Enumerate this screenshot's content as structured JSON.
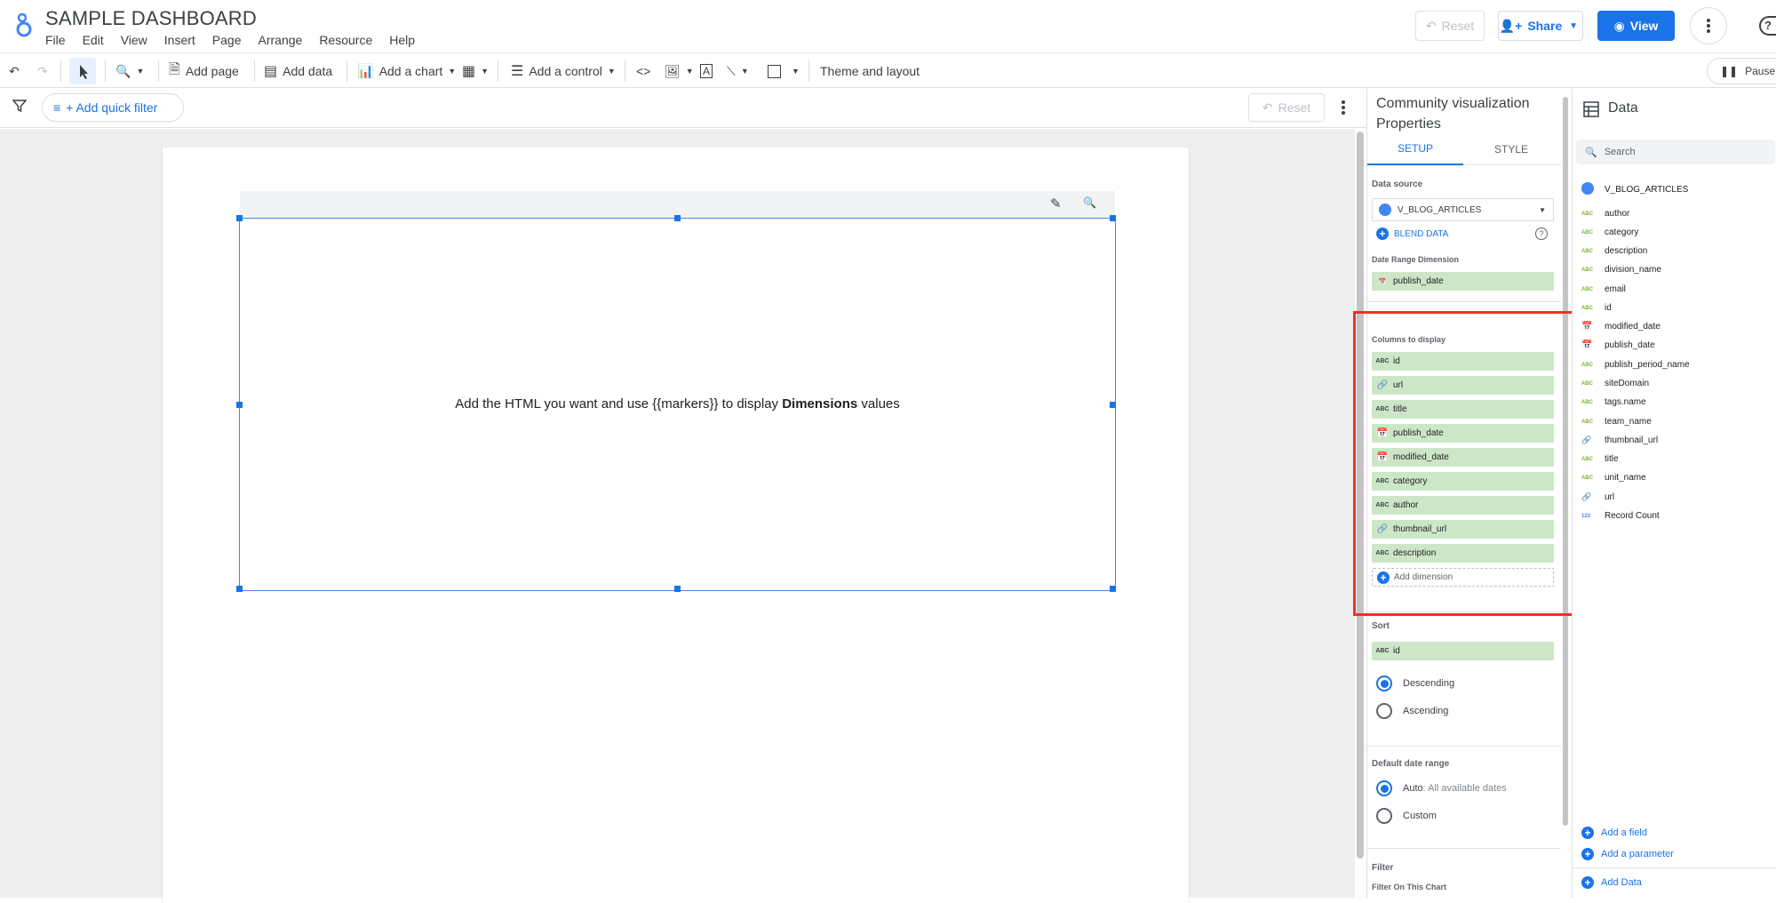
{
  "header": {
    "title": "SAMPLE DASHBOARD",
    "menu": [
      "File",
      "Edit",
      "View",
      "Insert",
      "Page",
      "Arrange",
      "Resource",
      "Help"
    ],
    "reset_label": "Reset",
    "share_label": "Share",
    "view_label": "View",
    "help_icon": "help-icon"
  },
  "toolbar": {
    "add_page": "Add page",
    "add_data": "Add data",
    "add_chart": "Add a chart",
    "add_control": "Add a control",
    "theme_layout": "Theme and layout",
    "pause": "Pause u"
  },
  "filterbar": {
    "quick_filter": "+ Add quick filter",
    "reset_label": "Reset"
  },
  "canvas": {
    "chart_message_pre": "Add the HTML you want and use {{markers}} to display ",
    "chart_message_bold": "Dimensions",
    "chart_message_post": " values"
  },
  "properties": {
    "title_line1": "Community visualization",
    "title_line2": "Properties",
    "tabs": [
      "SETUP",
      "STYLE"
    ],
    "data_source_label": "Data source",
    "data_source_value": "V_BLOG_ARTICLES",
    "blend_data": "BLEND DATA",
    "date_range_label": "Date Range Dimension",
    "date_range_value": "publish_date",
    "columns_label": "Columns to display",
    "columns": [
      {
        "icon": "ABC",
        "name": "id"
      },
      {
        "icon": "link",
        "name": "url"
      },
      {
        "icon": "ABC",
        "name": "title"
      },
      {
        "icon": "date",
        "name": "publish_date"
      },
      {
        "icon": "date",
        "name": "modified_date"
      },
      {
        "icon": "ABC",
        "name": "category"
      },
      {
        "icon": "ABC",
        "name": "author"
      },
      {
        "icon": "link",
        "name": "thumbnail_url"
      },
      {
        "icon": "ABC",
        "name": "description"
      }
    ],
    "add_dimension": "Add dimension",
    "sort_label": "Sort",
    "sort_value": "id",
    "sort_descending": "Descending",
    "sort_ascending": "Ascending",
    "default_date_label": "Default date range",
    "auto_label": "Auto",
    "auto_detail": ": All available dates",
    "custom_label": "Custom",
    "filter_label": "Filter",
    "filter_on_chart": "Filter On This Chart"
  },
  "data_panel": {
    "title": "Data",
    "search_placeholder": "Search",
    "source": "V_BLOG_ARTICLES",
    "fields": [
      {
        "type": "ABC",
        "name": "author"
      },
      {
        "type": "ABC",
        "name": "category"
      },
      {
        "type": "ABC",
        "name": "description"
      },
      {
        "type": "ABC",
        "name": "division_name"
      },
      {
        "type": "ABC",
        "name": "email"
      },
      {
        "type": "ABC",
        "name": "id"
      },
      {
        "type": "date",
        "name": "modified_date"
      },
      {
        "type": "date",
        "name": "publish_date"
      },
      {
        "type": "ABC",
        "name": "publish_period_name"
      },
      {
        "type": "ABC",
        "name": "siteDomain"
      },
      {
        "type": "ABC",
        "name": "tags.name"
      },
      {
        "type": "ABC",
        "name": "team_name"
      },
      {
        "type": "link",
        "name": "thumbnail_url"
      },
      {
        "type": "ABC",
        "name": "title"
      },
      {
        "type": "ABC",
        "name": "unit_name"
      },
      {
        "type": "link",
        "name": "url"
      },
      {
        "type": "123",
        "name": "Record Count"
      }
    ],
    "add_field": "Add a field",
    "add_parameter": "Add a parameter",
    "add_data": "Add Data"
  },
  "colors": {
    "accent": "#1a73e8",
    "chip_green": "#cde6c7",
    "highlight_red": "#ea3323"
  }
}
